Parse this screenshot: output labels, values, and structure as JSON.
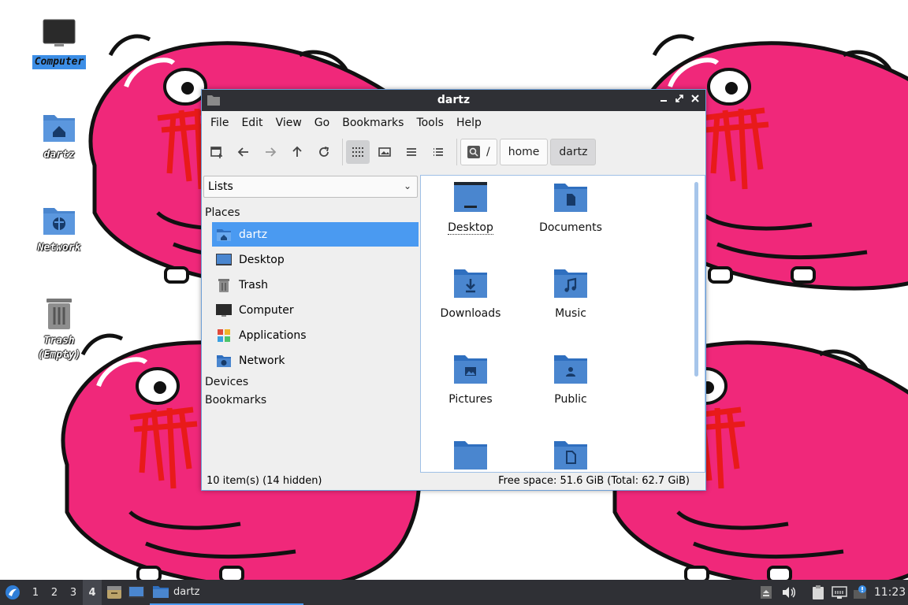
{
  "desktop": {
    "icons": [
      {
        "label": "Computer",
        "icon": "monitor-icon",
        "selected": true
      },
      {
        "label": "dartz",
        "icon": "home-folder-icon"
      },
      {
        "label": "Network",
        "icon": "network-folder-icon"
      },
      {
        "label": "Trash\n(Empty)",
        "icon": "trash-icon"
      }
    ]
  },
  "window": {
    "title": "dartz",
    "menu": [
      "File",
      "Edit",
      "View",
      "Go",
      "Bookmarks",
      "Tools",
      "Help"
    ],
    "breadcrumb": {
      "root": "/",
      "items": [
        "home",
        "dartz"
      ]
    },
    "sidebar": {
      "mode": "Lists",
      "places_header": "Places",
      "places": [
        {
          "label": "dartz",
          "icon": "home-folder-icon"
        },
        {
          "label": "Desktop",
          "icon": "desktop-icon"
        },
        {
          "label": "Trash",
          "icon": "trash-icon"
        },
        {
          "label": "Computer",
          "icon": "monitor-icon"
        },
        {
          "label": "Applications",
          "icon": "applications-icon"
        },
        {
          "label": "Network",
          "icon": "network-folder-icon"
        }
      ],
      "devices_header": "Devices",
      "bookmarks_header": "Bookmarks"
    },
    "files": [
      {
        "label": "Desktop",
        "icon": "desktop-folder-icon"
      },
      {
        "label": "Documents",
        "icon": "documents-folder-icon"
      },
      {
        "label": "Downloads",
        "icon": "downloads-folder-icon"
      },
      {
        "label": "Music",
        "icon": "music-folder-icon"
      },
      {
        "label": "Pictures",
        "icon": "pictures-folder-icon"
      },
      {
        "label": "Public",
        "icon": "public-folder-icon"
      },
      {
        "label": "",
        "icon": "folder-icon"
      },
      {
        "label": "",
        "icon": "templates-folder-icon"
      }
    ],
    "status": {
      "items": "10 item(s) (14 hidden)",
      "free": "Free space: 51.6 GiB (Total: 62.7 GiB)"
    }
  },
  "taskbar": {
    "workspaces": [
      "1",
      "2",
      "3",
      "4"
    ],
    "active_workspace": "4",
    "task": "dartz",
    "clock": "11:23"
  },
  "colors": {
    "accent": "#4a9af1",
    "folder": "#4a86cf",
    "wallpaper_pink": "#f0287a",
    "panel": "#2f3035"
  }
}
